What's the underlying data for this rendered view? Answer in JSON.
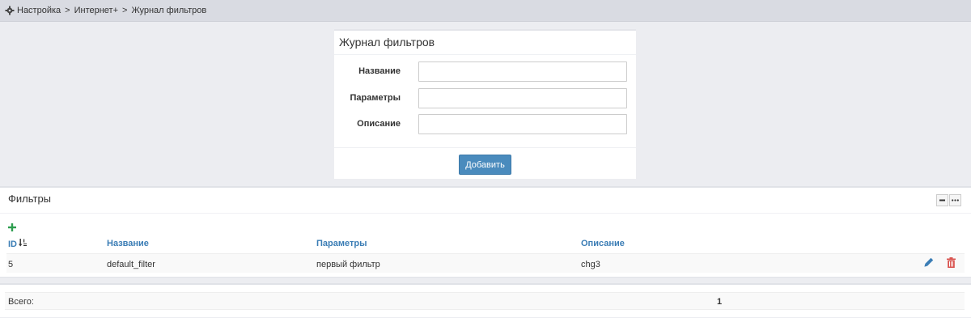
{
  "breadcrumb": {
    "items": [
      "Настройка",
      "Интернет+",
      "Журнал фильтров"
    ],
    "separator": ">"
  },
  "form": {
    "title": "Журнал фильтров",
    "fields": [
      {
        "label": "Название",
        "value": "",
        "placeholder": ""
      },
      {
        "label": "Параметры",
        "value": "",
        "placeholder": ""
      },
      {
        "label": "Описание",
        "value": "",
        "placeholder": ""
      }
    ],
    "submit_label": "Добавить"
  },
  "filters": {
    "title": "Фильтры",
    "columns": [
      "ID",
      "Название",
      "Параметры",
      "Описание"
    ],
    "rows": [
      {
        "id": "5",
        "name": "default_filter",
        "params": "первый фильтр",
        "description": "chg3"
      }
    ]
  },
  "total": {
    "label": "Всего:",
    "value": "1"
  },
  "colors": {
    "accent": "#4a8bbd",
    "header_link": "#3b7db5",
    "add_green": "#2e9e4f",
    "delete_red": "#d9534f"
  },
  "icons": [
    "gear-icon",
    "plus-icon",
    "sort-numeric-icon",
    "edit-pencil-icon",
    "trash-icon",
    "minimize-icon",
    "more-icon"
  ]
}
